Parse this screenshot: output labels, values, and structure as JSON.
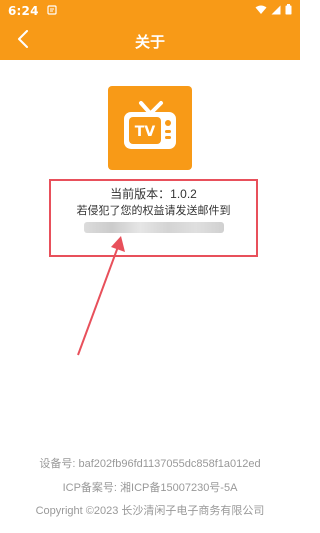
{
  "status_bar": {
    "time": "6:24"
  },
  "app_bar": {
    "title": "关于"
  },
  "about": {
    "version_label": "当前版本：",
    "version": "1.0.2",
    "report_text": "若侵犯了您的权益请发送邮件到"
  },
  "footer": {
    "device_label": "设备号:",
    "device_id": "baf202fb96fd1137055dc858f1a012ed",
    "icp_label": "ICP备案号:",
    "icp_number": "湘ICP备15007230号-5A",
    "copyright": "Copyright ©2023 长沙清闲子电子商务有限公司"
  },
  "colors": {
    "brand_orange": "#F89A17",
    "annotation_red": "#E8505B"
  },
  "icons": {
    "back": "chevron-left-icon",
    "logo": "tv-icon"
  }
}
